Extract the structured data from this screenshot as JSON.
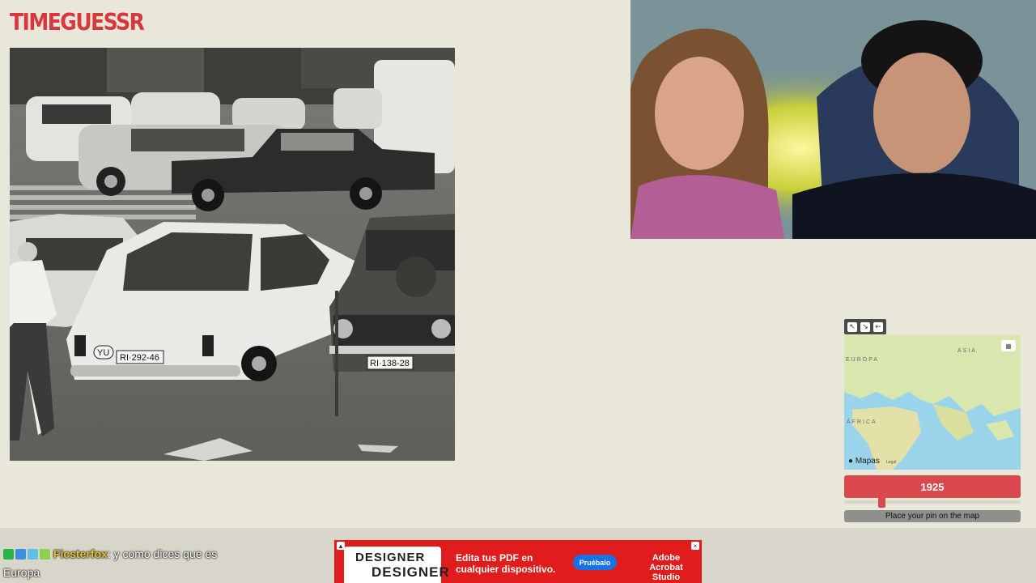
{
  "app": {
    "logo": "TIMEGUESSR"
  },
  "photo": {
    "plate_front_car": "RI·292-46",
    "plate_country": "YU",
    "plate_right_car": "RI·138-28"
  },
  "map_widget": {
    "tools": [
      "arrow-upleft-icon",
      "arrow-downright-icon",
      "arrow-left-icon"
    ],
    "labels": {
      "europe": "EUROPA",
      "asia": "ASIA",
      "africa": "ÁFRICA"
    },
    "brand": "Mapas",
    "legal": "Legal",
    "year": "1925",
    "slider_position": 0.2,
    "pin_button": "Place your pin on the map"
  },
  "chat": {
    "username": "Ficsterfox",
    "separator": ":",
    "message": " y como dices que es Europa"
  },
  "ad": {
    "logo_top": "DESIGNER",
    "logo_bottom": "DESIGNER",
    "text": "Edita tus PDF en cualquier dispositivo.",
    "cta": "Pruébalo",
    "brand_line1": "Adobe",
    "brand_line2": "Acrobat Studio"
  },
  "colors": {
    "accent": "#d8484c",
    "background": "#e9e7da",
    "ad_red": "#e01c1c",
    "ad_button": "#1473e6"
  }
}
